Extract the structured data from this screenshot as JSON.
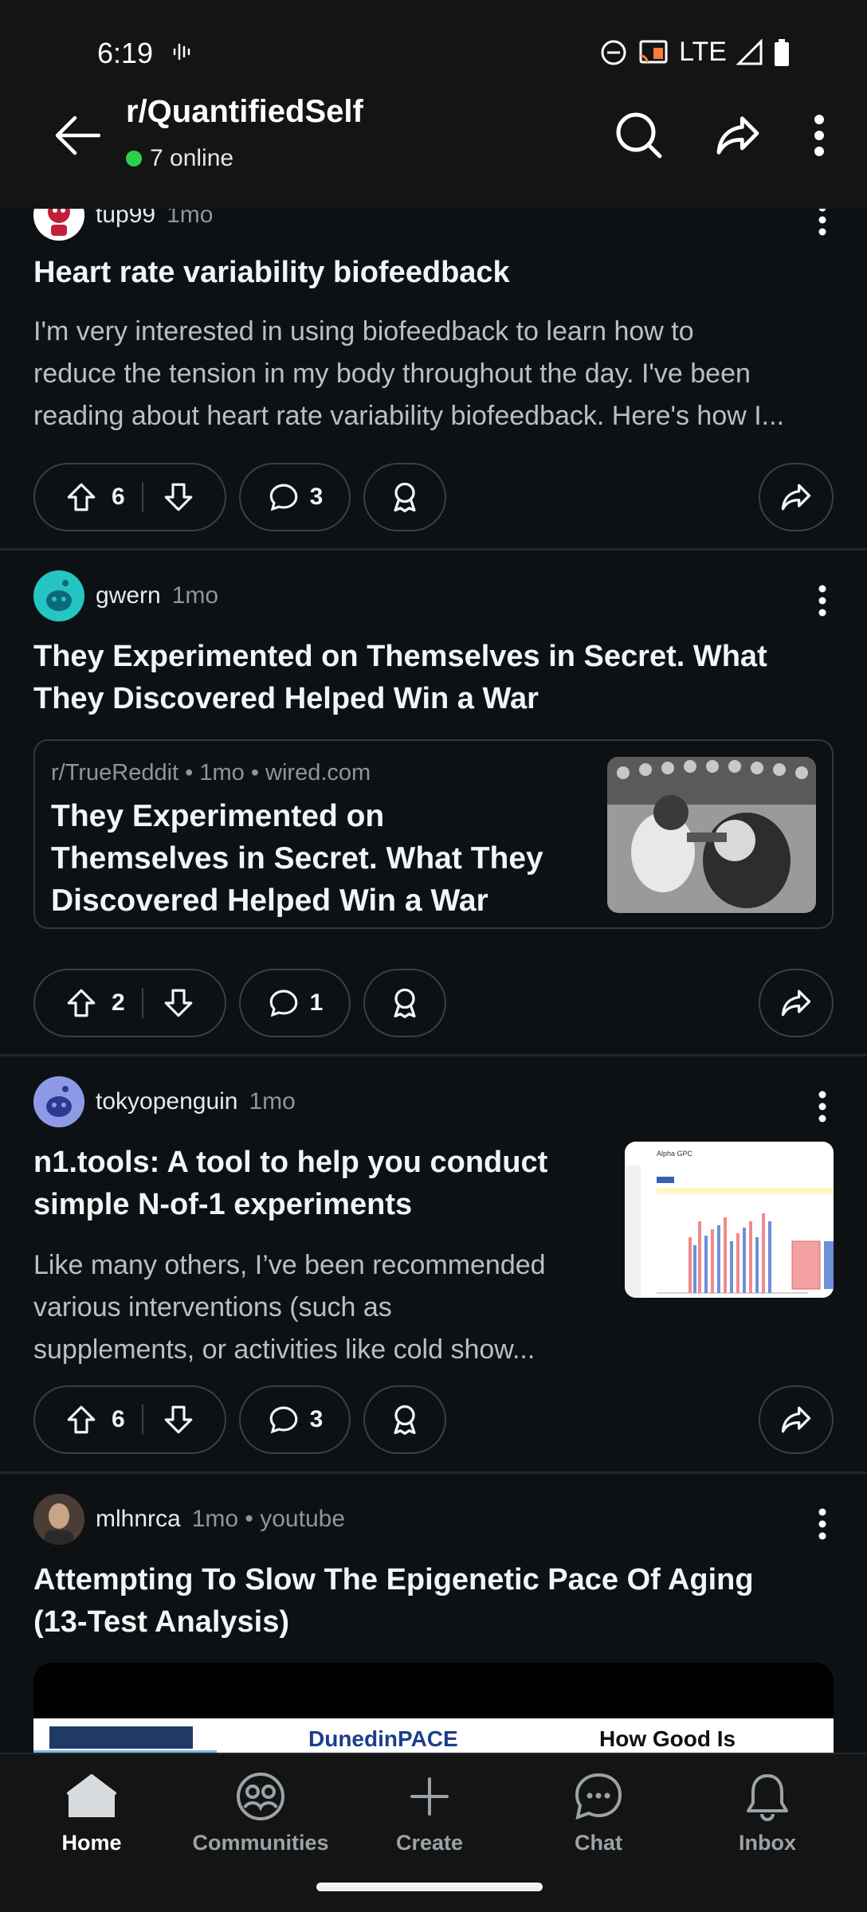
{
  "status_bar": {
    "time": "6:19",
    "network": "LTE"
  },
  "header": {
    "title": "r/QuantifiedSelf",
    "online": "7 online"
  },
  "posts": [
    {
      "author": "tup99",
      "time": "1mo",
      "title": "Heart rate variability biofeedback",
      "body_lines": [
        "I'm very interested in using biofeedback to learn how to",
        "reduce the tension in my body throughout the day. I've been",
        "reading about heart rate variability biofeedback. Here's how I..."
      ],
      "votes": "6",
      "comments": "3"
    },
    {
      "author": "gwern",
      "time": "1mo",
      "title_lines": [
        "They Experimented on Themselves in Secret. What",
        "They Discovered Helped Win a War"
      ],
      "link": {
        "meta": "r/TrueReddit • 1mo • wired.com",
        "title_lines": [
          "They Experimented on",
          "Themselves in Secret. What They",
          "Discovered Helped Win a War"
        ]
      },
      "votes": "2",
      "comments": "1"
    },
    {
      "author": "tokyopenguin",
      "time": "1mo",
      "title_lines": [
        "n1.tools: A tool to help you conduct",
        "simple N-of-1 experiments"
      ],
      "body_lines": [
        "Like many others, I’ve been recommended",
        "various interventions (such as",
        "supplements, or activities like cold show..."
      ],
      "thumb_title": "Alpha GPC",
      "votes": "6",
      "comments": "3"
    },
    {
      "author": "mlhnrca",
      "time": "1mo",
      "source": "youtube",
      "title_lines": [
        "Attempting To Slow The Epigenetic Pace Of Aging",
        "(13-Test Analysis)"
      ],
      "video_text_1": "DunedinPACE",
      "video_text_2": "How Good Is"
    }
  ],
  "bottom_nav": {
    "items": [
      {
        "label": "Home"
      },
      {
        "label": "Communities"
      },
      {
        "label": "Create"
      },
      {
        "label": "Chat"
      },
      {
        "label": "Inbox"
      }
    ]
  },
  "colors": {
    "background": "#0e1113",
    "accent_online": "#2bd14a",
    "text_primary": "#f2f4f5",
    "text_secondary": "#8c979c"
  }
}
